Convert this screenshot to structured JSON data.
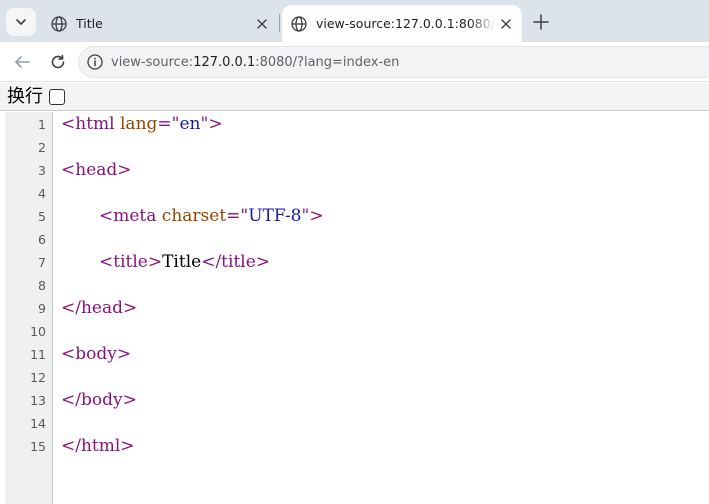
{
  "browser": {
    "tabs": [
      {
        "title": "Title",
        "active": false
      },
      {
        "title": "view-source:127.0.0.1:8080/?lang=index-en",
        "active": true
      }
    ],
    "address_bar": {
      "scheme": "view-source:",
      "host": "127.0.0.1",
      "rest": ":8080/?lang=index-en"
    }
  },
  "wrap_toggle": {
    "label": "换行",
    "checked": false
  },
  "source": {
    "lines": [
      {
        "n": "1",
        "indent": 0,
        "parts": [
          {
            "t": "tag",
            "v": "<html "
          },
          {
            "t": "attr",
            "v": "lang"
          },
          {
            "t": "tag",
            "v": "=\""
          },
          {
            "t": "val",
            "v": "en"
          },
          {
            "t": "tag",
            "v": "\">"
          }
        ]
      },
      {
        "n": "2",
        "indent": 0,
        "parts": []
      },
      {
        "n": "3",
        "indent": 0,
        "parts": [
          {
            "t": "tag",
            "v": "<head>"
          }
        ]
      },
      {
        "n": "4",
        "indent": 0,
        "parts": []
      },
      {
        "n": "5",
        "indent": 1,
        "parts": [
          {
            "t": "tag",
            "v": "<meta "
          },
          {
            "t": "attr",
            "v": "charset"
          },
          {
            "t": "tag",
            "v": "=\""
          },
          {
            "t": "val",
            "v": "UTF-8"
          },
          {
            "t": "tag",
            "v": "\">"
          }
        ]
      },
      {
        "n": "6",
        "indent": 0,
        "parts": []
      },
      {
        "n": "7",
        "indent": 1,
        "parts": [
          {
            "t": "tag",
            "v": "<title>"
          },
          {
            "t": "txt",
            "v": "Title"
          },
          {
            "t": "tag",
            "v": "</title>"
          }
        ]
      },
      {
        "n": "8",
        "indent": 0,
        "parts": []
      },
      {
        "n": "9",
        "indent": 0,
        "parts": [
          {
            "t": "tag",
            "v": "</head>"
          }
        ]
      },
      {
        "n": "10",
        "indent": 0,
        "parts": []
      },
      {
        "n": "11",
        "indent": 0,
        "parts": [
          {
            "t": "tag",
            "v": "<body>"
          }
        ]
      },
      {
        "n": "12",
        "indent": 0,
        "parts": []
      },
      {
        "n": "13",
        "indent": 0,
        "parts": [
          {
            "t": "tag",
            "v": "</body>"
          }
        ]
      },
      {
        "n": "14",
        "indent": 0,
        "parts": []
      },
      {
        "n": "15",
        "indent": 0,
        "parts": [
          {
            "t": "tag",
            "v": "</html>"
          }
        ]
      }
    ]
  },
  "icons": {
    "tab_search": "chevron-down-icon",
    "tab_favicon": "globe-icon",
    "tab_close": "close-icon",
    "new_tab": "plus-icon",
    "back": "back-arrow-icon",
    "reload": "reload-icon",
    "site_info": "info-icon"
  },
  "colors": {
    "tag": "#881280",
    "attribute": "#994500",
    "value": "#1a1aa6",
    "tabstrip": "#dde3ea"
  }
}
